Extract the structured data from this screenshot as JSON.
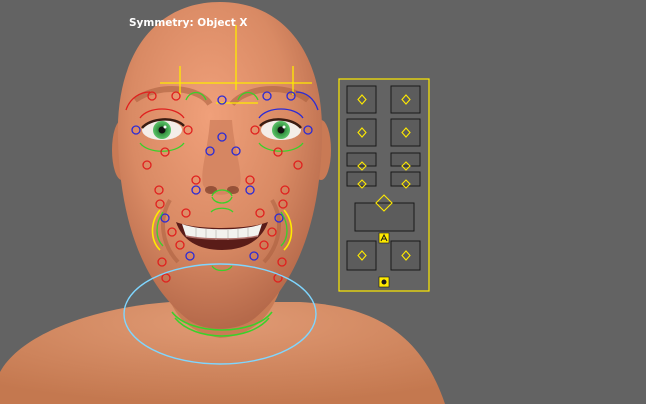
{
  "viewport": {
    "background": "#636363",
    "hud": {
      "symmetry_label": "Symmetry: Object X"
    }
  },
  "character": {
    "skin_color": "#d98a64",
    "iris_color": "#3fae4f"
  },
  "rig_colors": {
    "left_side": "#e0201e",
    "right_side": "#2b2bd6",
    "center": "#ffea00",
    "secondary": "#3ad12a",
    "neck": "#7fd6ff"
  },
  "face_control_panel": {
    "border_color": "#ffea00",
    "slot_rows": [
      "brow",
      "eye",
      "cheek-upper",
      "cheek-lower",
      "mouth",
      "jaw-sides",
      "neck"
    ]
  }
}
